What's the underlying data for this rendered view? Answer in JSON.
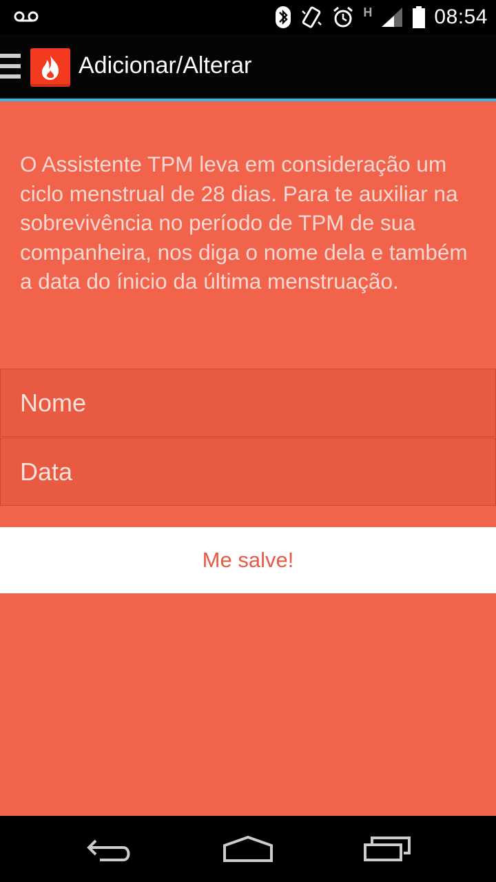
{
  "status_bar": {
    "time": "08:54",
    "icons": [
      "voicemail-icon",
      "bluetooth-icon",
      "vibrate-icon",
      "alarm-icon",
      "network-h-icon",
      "signal-icon",
      "battery-icon"
    ],
    "network_type": "H"
  },
  "action_bar": {
    "title": "Adicionar/Alterar",
    "logo_icon": "flame-icon",
    "accent_color": "#33b5e5"
  },
  "form": {
    "intro_text": "O Assistente TPM leva em consideração um ciclo menstrual de 28 dias. Para te auxiliar na sobrevivência no período de TPM de sua companheira, nos diga o nome dela e também a data do ínicio da última menstruação.",
    "name_placeholder": "Nome",
    "date_placeholder": "Data",
    "save_label": "Me salve!"
  },
  "colors": {
    "background": "#f2634c",
    "field_background": "#e95a43",
    "button_text": "#e85a44"
  },
  "nav_bar": {
    "icons": [
      "back-icon",
      "home-icon",
      "recent-apps-icon"
    ]
  }
}
